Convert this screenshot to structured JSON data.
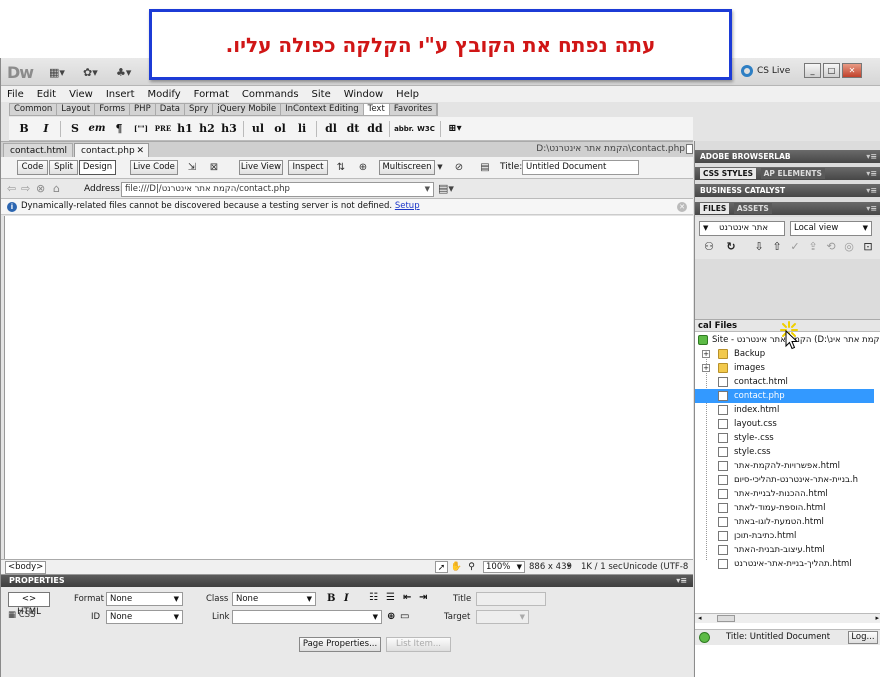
{
  "banner": {
    "text": "עתה נפתח את הקובץ ע\"י הקלקה כפולה עליו."
  },
  "app": {
    "logo": "Dw",
    "cs_live": "CS Live",
    "window_controls": [
      "_",
      "□",
      "✕"
    ]
  },
  "menu": [
    "File",
    "Edit",
    "View",
    "Insert",
    "Modify",
    "Format",
    "Commands",
    "Site",
    "Window",
    "Help"
  ],
  "insert_tabs": [
    "Common",
    "Layout",
    "Forms",
    "PHP",
    "Data",
    "Spry",
    "jQuery Mobile",
    "InContext Editing",
    "Text",
    "Favorites"
  ],
  "insert_tab_active": "Text",
  "text_buttons": [
    "B",
    "I",
    "S",
    "em",
    "¶",
    "[\"\"]",
    "PRE",
    "h1",
    "h2",
    "h3",
    "ul",
    "ol",
    "li",
    "dl",
    "dt",
    "dd",
    "abbr.",
    "W3C"
  ],
  "doc_tabs": [
    {
      "label": "contact.html"
    },
    {
      "label": "contact.php"
    }
  ],
  "doc_path": "D:\\הקמת אתר אינטרנט\\contact.php",
  "doc_toolbar": {
    "code": "Code",
    "split": "Split",
    "design": "Design",
    "live_code": "Live Code",
    "live_view": "Live View",
    "inspect": "Inspect",
    "multiscreen": "Multiscreen",
    "title_label": "Title:",
    "title_value": "Untitled Document"
  },
  "address": {
    "label": "Address:",
    "value": "file:///D|/הקמת אתר אינטרנט/contact.php"
  },
  "info": {
    "message": "Dynamically-related files cannot be discovered because a testing server is not defined.",
    "link": "Setup"
  },
  "statusbar": {
    "tag": "<body>",
    "zoom": "100%",
    "size": "886 x 439",
    "download": "1K / 1 sec",
    "encoding": "Unicode (UTF-8"
  },
  "properties": {
    "title": "PROPERTIES",
    "html_btn": "HTML",
    "css_btn": "CSS",
    "format_label": "Format",
    "format_value": "None",
    "id_label": "ID",
    "id_value": "None",
    "class_label": "Class",
    "class_value": "None",
    "link_label": "Link",
    "title_label": "Title",
    "target_label": "Target",
    "page_props": "Page Properties...",
    "list_item": "List Item..."
  },
  "right_panel": {
    "browserlab": "ADOBE BROWSERLAB",
    "css_styles": "CSS STYLES",
    "ap_elements": "AP ELEMENTS",
    "business_catalyst": "BUSINESS CATALYST",
    "files_tab": "FILES",
    "assets_tab": "ASSETS",
    "site_select": "אתר אינטרנט",
    "view_select": "Local view",
    "tree_header": "cal Files",
    "site_root": "Site - הקמת אתר אינטרנט (D:\\הקמת אתר אינ",
    "files": [
      {
        "name": "Backup",
        "type": "folder"
      },
      {
        "name": "images",
        "type": "folder"
      },
      {
        "name": "contact.html",
        "type": "file"
      },
      {
        "name": "contact.php",
        "type": "file",
        "selected": true
      },
      {
        "name": "index.html",
        "type": "file"
      },
      {
        "name": "layout.css",
        "type": "file"
      },
      {
        "name": "style-.css",
        "type": "file"
      },
      {
        "name": "style.css",
        "type": "file"
      },
      {
        "name": "אפשרויות-להקמת-אתר.html",
        "type": "file"
      },
      {
        "name": "בניית-אתר-אינטרנט-תהליכי-סיום.h",
        "type": "file"
      },
      {
        "name": "ההכנות-לבניית-אתר.html",
        "type": "file"
      },
      {
        "name": "הוספת-עמוד-לאתר.html",
        "type": "file"
      },
      {
        "name": "הטמעת-לוגו-באתר.html",
        "type": "file"
      },
      {
        "name": "כתיבת-תוכן.html",
        "type": "file"
      },
      {
        "name": "עיצוב-תבנית-האתר.html",
        "type": "file"
      },
      {
        "name": "תהליך-בניית-אתר-אינטרנט.html",
        "type": "file"
      }
    ],
    "status_title": "Title: Untitled Document",
    "log_btn": "Log..."
  }
}
